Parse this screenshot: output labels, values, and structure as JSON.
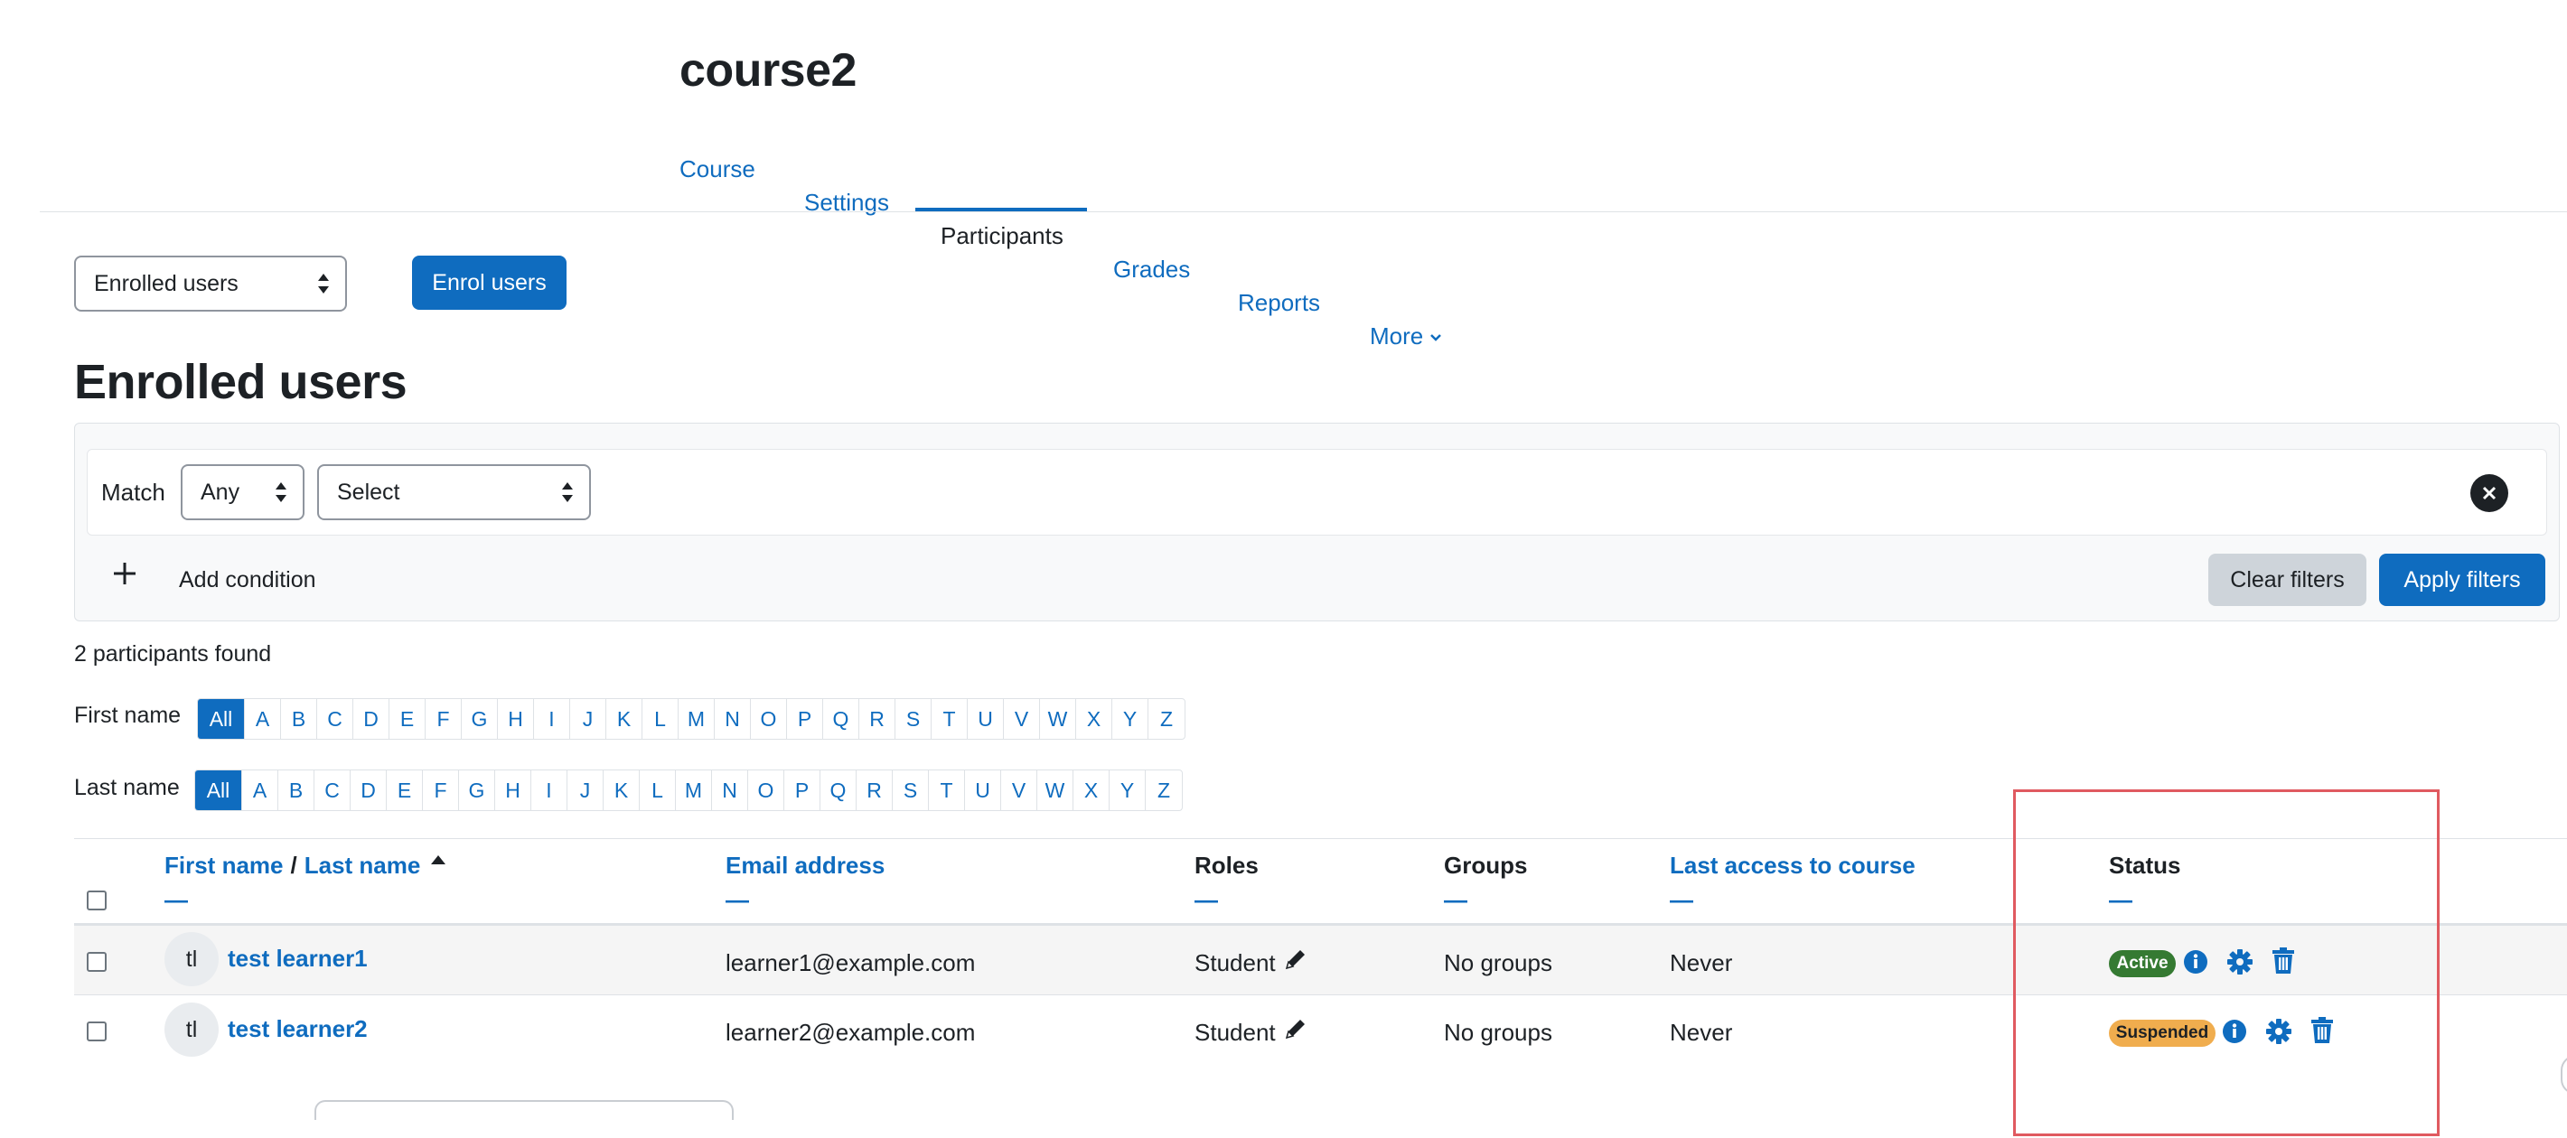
{
  "course": {
    "title": "course2"
  },
  "nav": {
    "items": [
      "Course",
      "Settings",
      "Participants",
      "Grades",
      "Reports",
      "More"
    ],
    "active": "Participants"
  },
  "toolbar": {
    "select_value": "Enrolled users",
    "enrol_button": "Enrol users"
  },
  "heading": "Enrolled users",
  "filters": {
    "match_label": "Match",
    "match_value": "Any",
    "type_value": "Select",
    "add_condition": "Add condition",
    "clear_button": "Clear filters",
    "apply_button": "Apply filters"
  },
  "summary": {
    "found": "2 participants found"
  },
  "initials": {
    "first_label": "First name",
    "last_label": "Last name",
    "all": "All",
    "letters": [
      "A",
      "B",
      "C",
      "D",
      "E",
      "F",
      "G",
      "H",
      "I",
      "J",
      "K",
      "L",
      "M",
      "N",
      "O",
      "P",
      "Q",
      "R",
      "S",
      "T",
      "U",
      "V",
      "W",
      "X",
      "Y",
      "Z"
    ]
  },
  "table": {
    "headers": {
      "first_name": "First name",
      "separator": "/",
      "last_name": "Last name",
      "email": "Email address",
      "roles": "Roles",
      "groups": "Groups",
      "last_access": "Last access to course",
      "status": "Status",
      "dash": "—"
    },
    "rows": [
      {
        "initials": "tl",
        "name": "test learner1",
        "email": "learner1@example.com",
        "role": "Student",
        "groups": "No groups",
        "last_access": "Never",
        "status": "Active"
      },
      {
        "initials": "tl",
        "name": "test learner2",
        "email": "learner2@example.com",
        "role": "Student",
        "groups": "No groups",
        "last_access": "Never",
        "status": "Suspended"
      }
    ]
  },
  "colors": {
    "primary": "#0f6cbf",
    "active_badge": "#357a32",
    "suspended_badge": "#f0ad4e",
    "highlight": "#e05a60"
  }
}
